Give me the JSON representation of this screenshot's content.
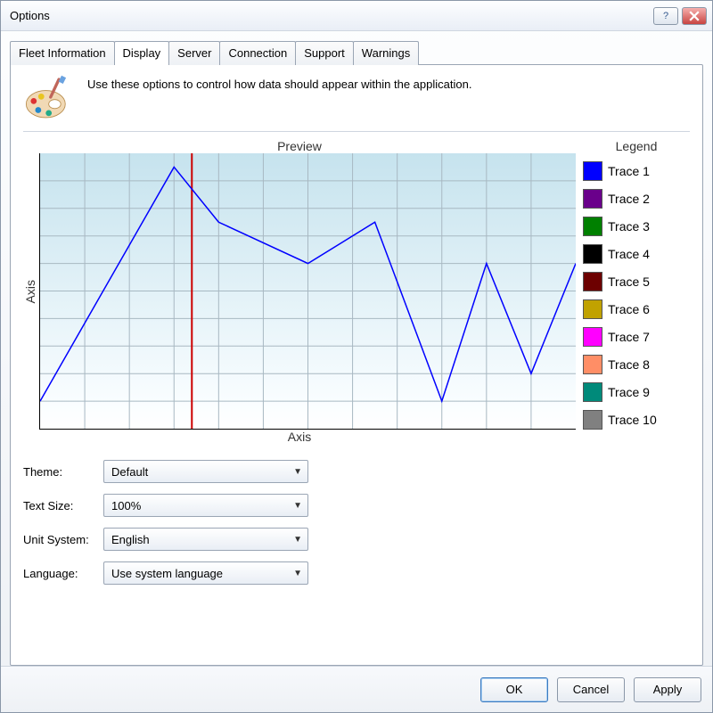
{
  "window": {
    "title": "Options"
  },
  "titlebar_buttons": {
    "help_label": "?",
    "close_label": "✕"
  },
  "tabs": [
    {
      "label": "Fleet Information",
      "active": false
    },
    {
      "label": "Display",
      "active": true
    },
    {
      "label": "Server",
      "active": false
    },
    {
      "label": "Connection",
      "active": false
    },
    {
      "label": "Support",
      "active": false
    },
    {
      "label": "Warnings",
      "active": false
    }
  ],
  "intro": "Use these options to control how data should appear within the application.",
  "chart_title": "Preview",
  "legend_title": "Legend",
  "axis_label_x": "Axis",
  "axis_label_y": "Axis",
  "chart_data": {
    "type": "line",
    "title": "Preview",
    "xlabel": "Axis",
    "ylabel": "Axis",
    "xlim": [
      0,
      12
    ],
    "ylim": [
      0,
      10
    ],
    "series": [
      {
        "name": "Trace 1",
        "color": "#0000ff",
        "x": [
          0,
          3,
          4,
          6,
          7.5,
          9,
          10,
          11,
          12
        ],
        "y": [
          1,
          9.5,
          7.5,
          6,
          7.5,
          1,
          6,
          2,
          6
        ]
      }
    ],
    "vlines": [
      {
        "x": 3.4,
        "color": "#cc0000"
      }
    ],
    "grid": {
      "vlines": 12,
      "hlines": 10
    },
    "legend": [
      {
        "name": "Trace 1",
        "color": "#0000ff"
      },
      {
        "name": "Trace 2",
        "color": "#6a008b"
      },
      {
        "name": "Trace 3",
        "color": "#008000"
      },
      {
        "name": "Trace 4",
        "color": "#000000"
      },
      {
        "name": "Trace 5",
        "color": "#6d0000"
      },
      {
        "name": "Trace 6",
        "color": "#c1a200"
      },
      {
        "name": "Trace 7",
        "color": "#ff00ff"
      },
      {
        "name": "Trace 8",
        "color": "#ff8e66"
      },
      {
        "name": "Trace 9",
        "color": "#008a7a"
      },
      {
        "name": "Trace 10",
        "color": "#808080"
      }
    ]
  },
  "form": {
    "theme": {
      "label": "Theme:",
      "value": "Default"
    },
    "textsize": {
      "label": "Text Size:",
      "value": "100%"
    },
    "unitsystem": {
      "label": "Unit System:",
      "value": "English"
    },
    "language": {
      "label": "Language:",
      "value": "Use system language"
    }
  },
  "buttons": {
    "ok": "OK",
    "cancel": "Cancel",
    "apply": "Apply"
  }
}
